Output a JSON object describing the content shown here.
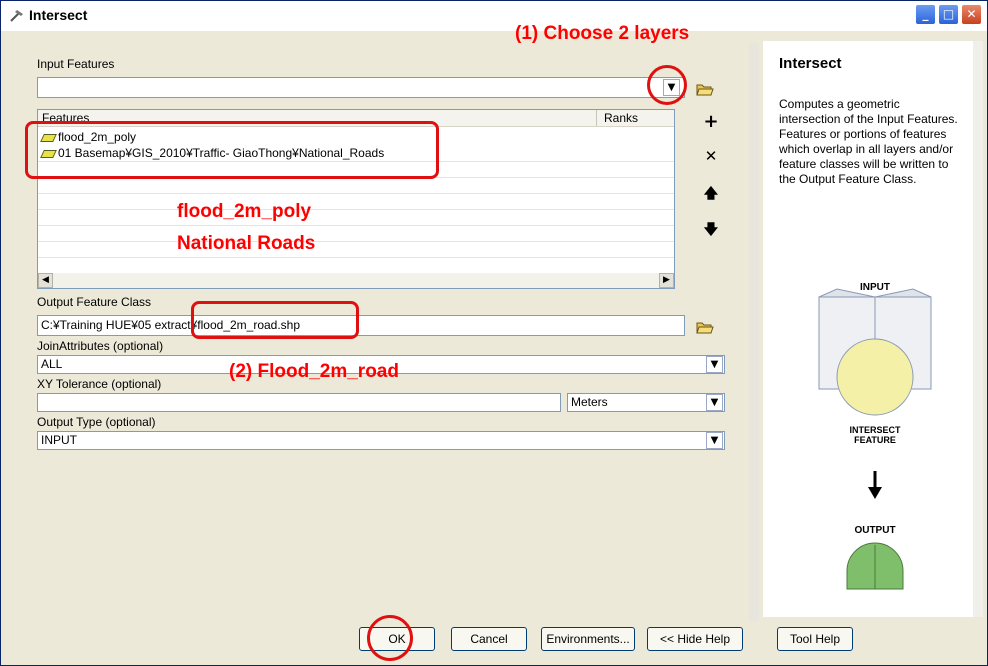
{
  "window": {
    "title": "Intersect",
    "icon": "hammer-icon",
    "minimize_glyph": "_",
    "maximize_glyph": "□",
    "close_glyph": "✕"
  },
  "annotations": {
    "choose_layers": "(1)  Choose 2 layers",
    "layers_note_1": "flood_2m_poly",
    "layers_note_2": "National Roads",
    "output_note": "(2)  Flood_2m_road",
    "color": "#ff0000"
  },
  "form": {
    "input_features_label": "Input Features",
    "input_features_value": "",
    "table": {
      "col_features": "Features",
      "col_ranks": "Ranks",
      "rows": [
        {
          "feature": "flood_2m_poly",
          "rank": ""
        },
        {
          "feature": "01  Basemap¥GIS_2010¥Traffic- GiaoThong¥National_Roads",
          "rank": ""
        }
      ]
    },
    "side_buttons": {
      "add": "+",
      "remove": "✕",
      "up": "🡅",
      "down": "🡇"
    },
    "output_label": "Output Feature Class",
    "output_value": "C:¥Training HUE¥05 extract¥flood_2m_road.shp",
    "join_label": "JoinAttributes (optional)",
    "join_value": "ALL",
    "xy_label": "XY Tolerance (optional)",
    "xy_value": "",
    "xy_units": "Meters",
    "output_type_label": "Output Type (optional)",
    "output_type_value": "INPUT"
  },
  "help": {
    "title": "Intersect",
    "body": "Computes a geometric intersection of the Input Features. Features or portions of features which overlap in all layers and/or feature classes will be written to the Output Feature Class.",
    "diagram": {
      "input_label": "INPUT",
      "intersect_label_1": "INTERSECT",
      "intersect_label_2": "FEATURE",
      "output_label": "OUTPUT"
    }
  },
  "buttons": {
    "ok": "OK",
    "cancel": "Cancel",
    "environments": "Environments...",
    "hide_help": "<< Hide Help",
    "tool_help": "Tool Help"
  }
}
